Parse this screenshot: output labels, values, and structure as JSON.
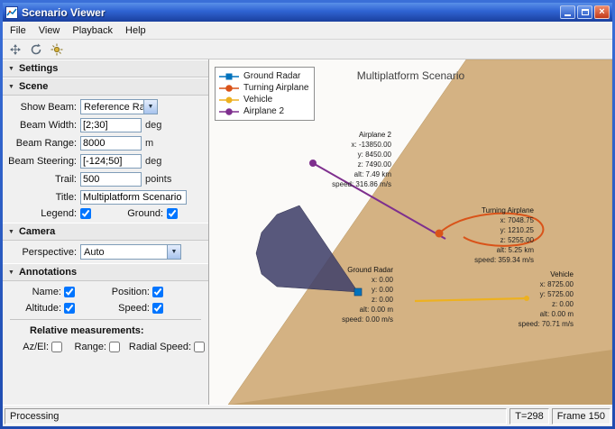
{
  "window": {
    "title": "Scenario Viewer"
  },
  "menu": {
    "items": [
      "File",
      "View",
      "Playback",
      "Help"
    ]
  },
  "toolbar": {
    "buttons": [
      "camera-pan",
      "camera-rotate",
      "scene-light"
    ]
  },
  "settings": {
    "title": "Settings",
    "scene": {
      "title": "Scene",
      "show_beam": {
        "label": "Show Beam:",
        "value": "Reference Radar"
      },
      "beam_width": {
        "label": "Beam Width:",
        "value": "[2;30]",
        "unit": "deg"
      },
      "beam_range": {
        "label": "Beam Range:",
        "value": "8000",
        "unit": "m"
      },
      "beam_steering": {
        "label": "Beam Steering:",
        "value": "[-124;50]",
        "unit": "deg"
      },
      "trail": {
        "label": "Trail:",
        "value": "500",
        "unit": "points"
      },
      "scene_title": {
        "label": "Title:",
        "value": "Multiplatform Scenario"
      },
      "legend": {
        "label": "Legend:",
        "checked": true
      },
      "ground": {
        "label": "Ground:",
        "checked": true
      }
    },
    "camera": {
      "title": "Camera",
      "perspective": {
        "label": "Perspective:",
        "value": "Auto"
      }
    },
    "annotations": {
      "title": "Annotations",
      "name": {
        "label": "Name:",
        "checked": true
      },
      "position": {
        "label": "Position:",
        "checked": true
      },
      "altitude": {
        "label": "Altitude:",
        "checked": true
      },
      "speed": {
        "label": "Speed:",
        "checked": true
      },
      "relative_title": "Relative measurements:",
      "azel": {
        "label": "Az/El:",
        "checked": false
      },
      "range": {
        "label": "Range:",
        "checked": false
      },
      "radial_speed": {
        "label": "Radial Speed:",
        "checked": false
      }
    }
  },
  "plot": {
    "title": "Multiplatform Scenario",
    "legend": [
      {
        "label": "Ground Radar",
        "color": "#0072BD"
      },
      {
        "label": "Turning Airplane",
        "color": "#D95319"
      },
      {
        "label": "Vehicle",
        "color": "#EDB120"
      },
      {
        "label": "Airplane 2",
        "color": "#7E2F8E"
      }
    ],
    "colors": {
      "ground": "#d4b283",
      "ground_dark": "#c3a06c",
      "beam": "#41416a"
    },
    "platforms": [
      {
        "name": "Airplane 2",
        "x": "x: -13850.00",
        "y": "y: 8450.00",
        "z": "z: 7490.00",
        "alt": "alt: 7.49 km",
        "speed": "speed: 316.86 m/s"
      },
      {
        "name": "Turning Airplane",
        "x": "x: 7048.75",
        "y": "y: 1210.25",
        "z": "z: 5255.00",
        "alt": "alt: 5.25 km",
        "speed": "speed: 359.34 m/s"
      },
      {
        "name": "Ground Radar",
        "x": "x: 0.00",
        "y": "y: 0.00",
        "z": "z: 0.00",
        "alt": "alt: 0.00 m",
        "speed": "speed: 0.00 m/s"
      },
      {
        "name": "Vehicle",
        "x": "x: 8725.00",
        "y": "y: 5725.00",
        "z": "z: 0.00",
        "alt": "alt: 0.00 m",
        "speed": "speed: 70.71 m/s"
      }
    ]
  },
  "statusbar": {
    "status": "Processing",
    "time": "T=298",
    "frame": "Frame 150"
  }
}
